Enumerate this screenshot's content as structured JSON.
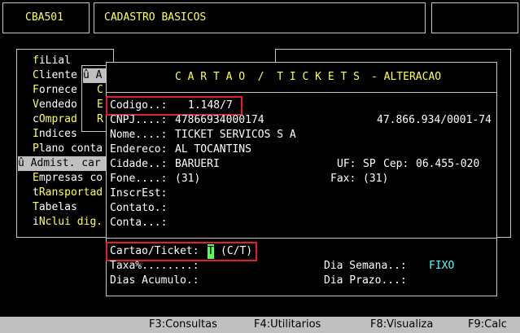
{
  "header": {
    "code": "CBA501",
    "title": "CADASTRO BASICOS"
  },
  "menu": {
    "items": [
      {
        "prefix": "",
        "hot": "f",
        "rest": "iLial"
      },
      {
        "prefix": "",
        "hot": "C",
        "rest": "liente"
      },
      {
        "prefix": "",
        "hot": "F",
        "rest": "ornece"
      },
      {
        "prefix": "",
        "hot": "V",
        "rest": "endedo"
      },
      {
        "prefix": "",
        "hot": "c",
        "rest": "Omprad"
      },
      {
        "prefix": "",
        "hot": "I",
        "rest": "ndices"
      },
      {
        "prefix": "",
        "hot": "P",
        "rest": "lano conta"
      },
      {
        "prefix": "û ",
        "hot": "A",
        "rest": "dmist. car"
      },
      {
        "prefix": "",
        "hot": "E",
        "rest": "mpresas co"
      },
      {
        "prefix": "",
        "hot": "t",
        "rest": "Ransportad"
      },
      {
        "prefix": "",
        "hot": "T",
        "rest": "abelas"
      },
      {
        "prefix": "",
        "hot": "i",
        "rest": "Nclui dig."
      }
    ],
    "submenu_items": [
      "û A",
      "C",
      "E",
      "R"
    ]
  },
  "dialog": {
    "title": "C A R T A O  /  T I C K E T S",
    "mode": "- ALTERACAO",
    "codigo_label": "Codigo..:",
    "codigo_value": "1.148/7",
    "cnpj_label": "CNPJ....:",
    "cnpj_value": "47866934000174",
    "cnpj_formatted": "47.866.934/0001-74",
    "nome_label": "Nome....:",
    "nome_value": "TICKET SERVICOS S A",
    "endereco_label": "Endereco:",
    "endereco_value": "AL TOCANTINS",
    "cidade_label": "Cidade..:",
    "cidade_value": "BARUERI",
    "uf_label": "UF:",
    "uf_value": "SP",
    "cep_label": "Cep:",
    "cep_value": "06.455-020",
    "fone_label": "Fone....:",
    "fone_value": "(31)",
    "fax_label": "Fax:",
    "fax_value": "(31)",
    "inscrest_label": "InscrEst:",
    "contato_label": "Contato.:",
    "conta_label": "Conta...:",
    "cartao_label": "Cartao/Ticket:",
    "cartao_value": "T",
    "cartao_hint": "(C/T)",
    "taxa_label": "Taxa%........:",
    "dias_acumulo_label": "Dias Acumulo.:",
    "dia_semana_label": "Dia Semana..:",
    "dia_semana_value": "FIXO",
    "dia_prazo_label": "Dia Prazo...:"
  },
  "statusbar": {
    "f3": "F3:Consultas",
    "f4": "F4:Utilitarios",
    "f8": "F8:Visualiza",
    "f9": "F9:Calc"
  }
}
